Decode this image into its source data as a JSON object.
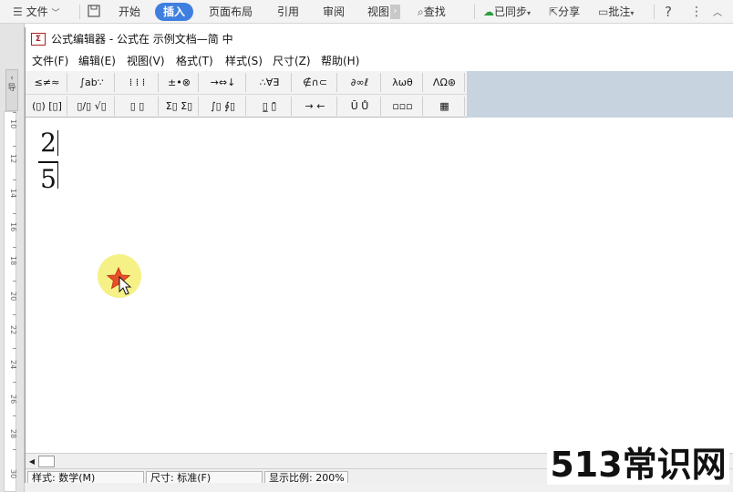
{
  "host": {
    "ribbon_items": [
      {
        "label": "文件",
        "icon": "hamburger-menu-icon",
        "has_dropdown": true
      },
      {
        "label": "",
        "icon": "save-icon"
      },
      {
        "label": "开始"
      },
      {
        "label": "插入",
        "active": true
      },
      {
        "label": "页面布局"
      },
      {
        "label": "引用"
      },
      {
        "label": "审阅"
      },
      {
        "label": "视图"
      },
      {
        "label": "查找",
        "icon": "search-icon"
      },
      {
        "label": "已同步",
        "icon": "cloud-sync-icon",
        "has_dropdown": true
      },
      {
        "label": "分享",
        "icon": "share-icon"
      },
      {
        "label": "批注",
        "icon": "comment-icon",
        "has_dropdown": true
      },
      {
        "label": "",
        "icon": "help-icon"
      },
      {
        "label": "",
        "icon": "more-icon"
      },
      {
        "label": "",
        "icon": "collapse-icon"
      }
    ],
    "left_tab_label": "导",
    "ruler_ticks": [
      "10",
      "12",
      "14",
      "16",
      "18",
      "20",
      "22",
      "24",
      "26",
      "28",
      "30"
    ],
    "accent_color": "#3f7fe0"
  },
  "editor": {
    "title": "公式编辑器 - 公式在 示例文档—简 中",
    "title_icon": "equation-editor-logo-icon",
    "logo_glyph": "Σ",
    "menu": [
      "文件(F)",
      "编辑(E)",
      "视图(V)",
      "格式(T)",
      "样式(S)",
      "尺寸(Z)",
      "帮助(H)"
    ],
    "toolbar_row1": [
      "≤≠≈",
      "∫ab∵",
      "⁞ ⁞ ⁞",
      "±•⊗",
      "→⇔↓",
      "∴∀∃",
      "∉∩⊂",
      "∂∞ℓ",
      "λωθ",
      "ΛΩ⊛"
    ],
    "toolbar_row2": [
      "(▯) [▯]",
      "▯/▯ √▯",
      "▯ ▯",
      "Σ▯ Σ▯",
      "∫▯ ∮▯",
      "▯̲ ▯̄",
      "→ ←",
      "Ū Ů",
      "▫▫▫",
      "▦"
    ],
    "equation": {
      "numerator": "2",
      "denominator": "5"
    },
    "cursor_icon": "mouse-pointer-icon",
    "status": {
      "style": "样式: 数学(M)",
      "size": "尺寸: 标准(F)",
      "zoom": "显示比例: 200%"
    }
  },
  "watermark": "513常识网"
}
